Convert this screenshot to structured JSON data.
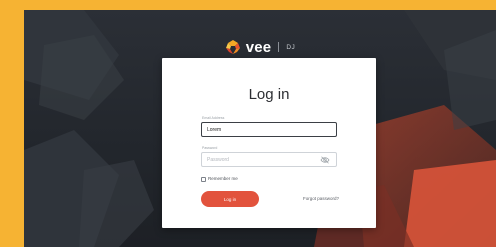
{
  "brand": {
    "name": "vee",
    "sub": "DJ"
  },
  "login": {
    "title": "Log in",
    "email_label": "Email Address",
    "email_value": "Lorem",
    "password_label": "Password",
    "password_placeholder": "Password",
    "remember_label": "Remember me",
    "submit_label": "Log in",
    "forgot_label": "Forgot password?"
  },
  "colors": {
    "frame": "#f6b333",
    "accent": "#e2533d",
    "background": "#25292f"
  },
  "icons": {
    "brand": "vee-logo-icon",
    "password_toggle": "eye-off-icon",
    "checkbox": "checkbox-icon"
  }
}
